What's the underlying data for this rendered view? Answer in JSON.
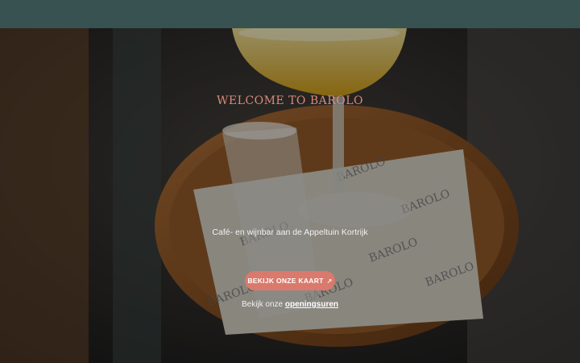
{
  "hero": {
    "welcome": "WELCOME TO BAROLO",
    "subtitle": "Café- en wijnbar aan de Appeltuin Kortrijk",
    "cta_label": "BEKIJK ONZE KAART",
    "cta_icon": "arrow-up-right-icon",
    "hours_prefix": "Bekijk onze ",
    "hours_link": "openingsuren",
    "background_image": "cocktail-on-wooden-tray-photo",
    "napkin_logo": "BAROLO"
  },
  "colors": {
    "topbar": "#375250",
    "accent": "#d97a6c",
    "welcome_text": "#d98a7a"
  }
}
